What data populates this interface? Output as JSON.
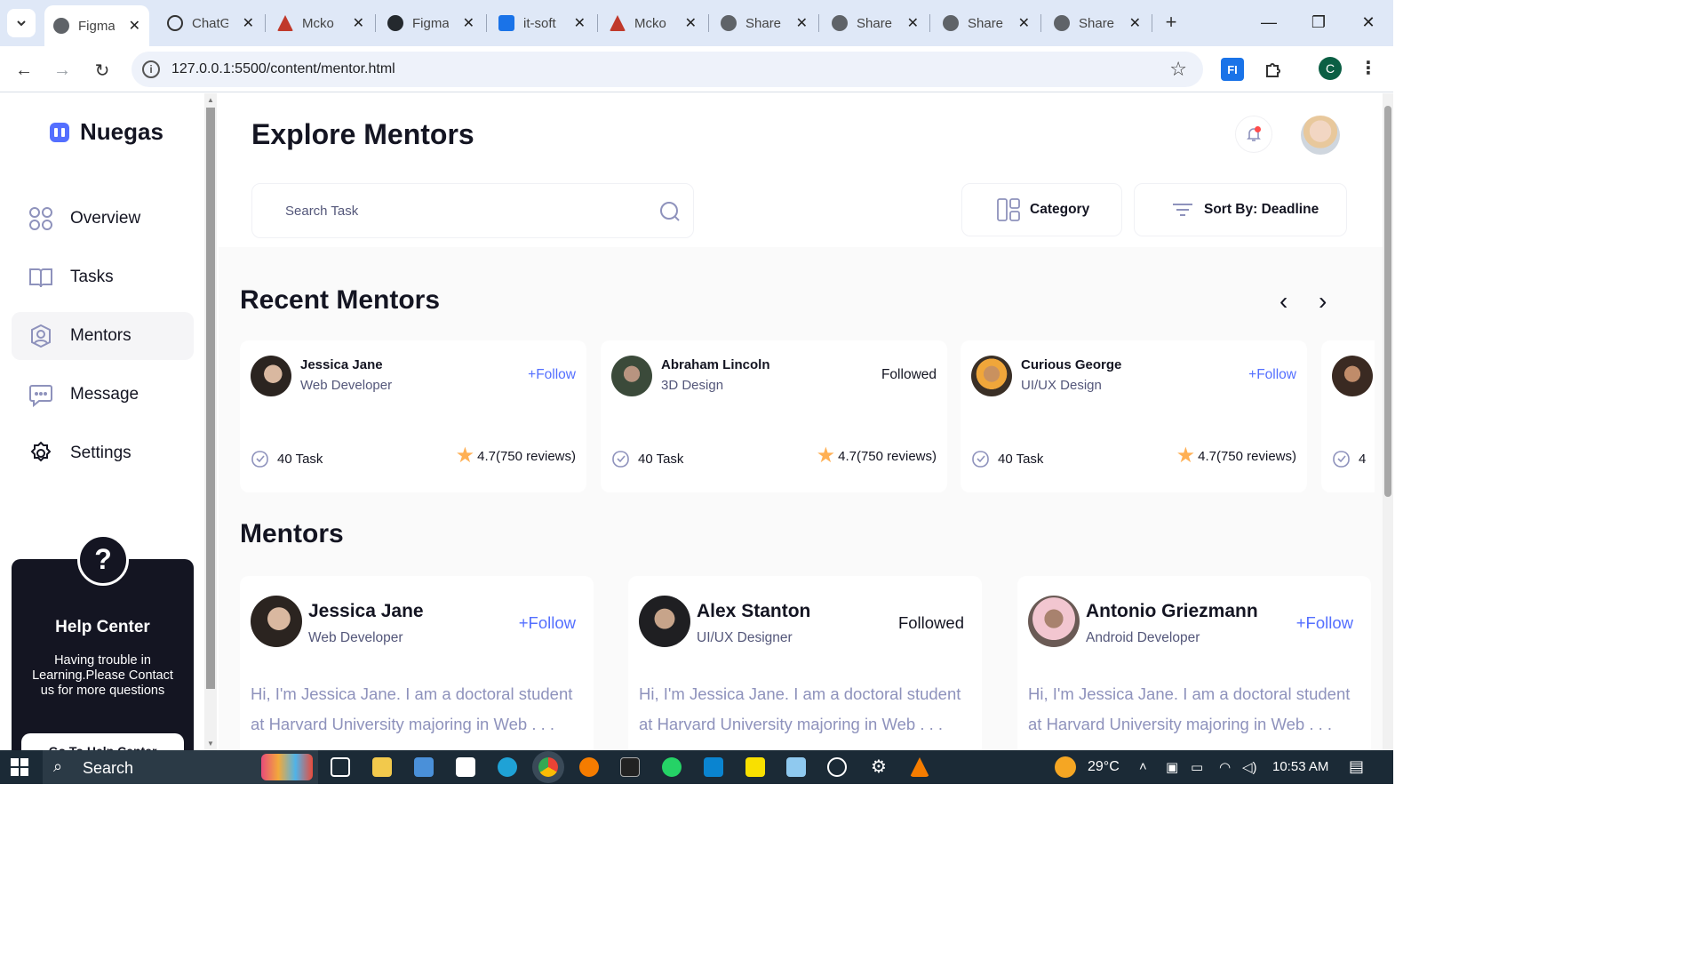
{
  "browser": {
    "tabs": [
      {
        "label": "Figma",
        "icon": "globe-icon",
        "active": true
      },
      {
        "label": "ChatG",
        "icon": "openai-icon"
      },
      {
        "label": "Mcko",
        "icon": "mcko-icon"
      },
      {
        "label": "Figma",
        "icon": "github-icon"
      },
      {
        "label": "it-soft",
        "icon": "shield-icon"
      },
      {
        "label": "Mcko",
        "icon": "mcko-icon"
      },
      {
        "label": "Share",
        "icon": "globe-icon"
      },
      {
        "label": "Share",
        "icon": "globe-icon"
      },
      {
        "label": "Share",
        "icon": "globe-icon"
      },
      {
        "label": "Share",
        "icon": "globe-icon"
      }
    ],
    "url": "127.0.0.1:5500/content/mentor.html",
    "profile_initial": "C",
    "extension_label": "FI"
  },
  "sidebar": {
    "brand": "Nuegas",
    "items": [
      {
        "label": "Overview",
        "icon": "overview-icon"
      },
      {
        "label": "Tasks",
        "icon": "book-icon"
      },
      {
        "label": "Mentors",
        "icon": "user-circle-icon",
        "active": true
      },
      {
        "label": "Message",
        "icon": "chat-icon"
      },
      {
        "label": "Settings",
        "icon": "gear-icon"
      }
    ],
    "help": {
      "badge": "?",
      "title": "Help Center",
      "text": "Having trouble in Learning.Please Contact us for more questions",
      "button": "Go To Help Center"
    }
  },
  "header": {
    "title": "Explore Mentors",
    "search_placeholder": "Search Task",
    "category_label": "Category",
    "sort_label": "Sort By: Deadline"
  },
  "recent": {
    "title": "Recent Mentors",
    "cards": [
      {
        "name": "Jessica Jane",
        "role": "Web Developer",
        "follow": "+Follow",
        "followed": false,
        "tasks": "40 Task",
        "rating": "4.7(750 reviews)"
      },
      {
        "name": "Abraham Lincoln",
        "role": "3D Design",
        "follow": "Followed",
        "followed": true,
        "tasks": "40 Task",
        "rating": "4.7(750 reviews)"
      },
      {
        "name": "Curious George",
        "role": "UI/UX Design",
        "follow": "+Follow",
        "followed": false,
        "tasks": "40 Task",
        "rating": "4.7(750 reviews)"
      },
      {
        "tasks": "4"
      }
    ]
  },
  "mentors": {
    "title": "Mentors",
    "cards": [
      {
        "name": "Jessica Jane",
        "role": "Web Developer",
        "follow": "+Follow",
        "followed": false,
        "bio": "Hi, I'm Jessica Jane. I am a doctoral student at Harvard University majoring in Web . . ."
      },
      {
        "name": "Alex Stanton",
        "role": "UI/UX Designer",
        "follow": "Followed",
        "followed": true,
        "bio": "Hi, I'm Jessica Jane. I am a doctoral student at Harvard University majoring in Web . . ."
      },
      {
        "name": "Antonio Griezmann",
        "role": "Android Developer",
        "follow": "+Follow",
        "followed": false,
        "bio": "Hi, I'm Jessica Jane. I am a doctoral student at Harvard University majoring in Web . . ."
      }
    ]
  },
  "taskbar": {
    "search_label": "Search",
    "temperature": "29°C",
    "time": "10:53 AM"
  },
  "colors": {
    "accent": "#546fff",
    "text_primary": "#141522",
    "text_secondary": "#54577a",
    "bio_text": "#8e92bc",
    "star": "#ffb054",
    "help_bg": "#141522"
  }
}
